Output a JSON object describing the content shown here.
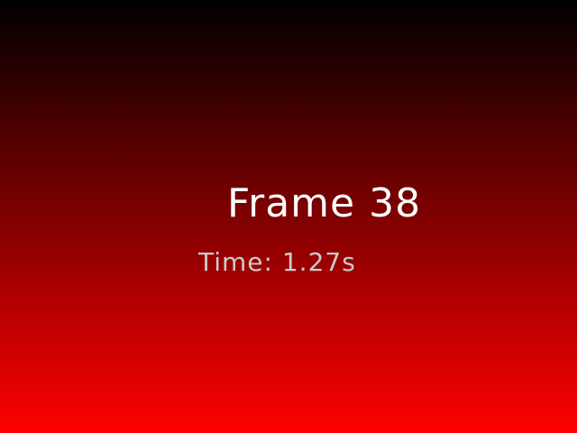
{
  "frame": {
    "text": "Frame 38"
  },
  "time": {
    "text": "Time: 1.27s"
  },
  "colors": {
    "gradient_top": "#000000",
    "gradient_bottom": "#ff0000",
    "frame_text": "#ffffff",
    "time_text": "#cccccc"
  }
}
